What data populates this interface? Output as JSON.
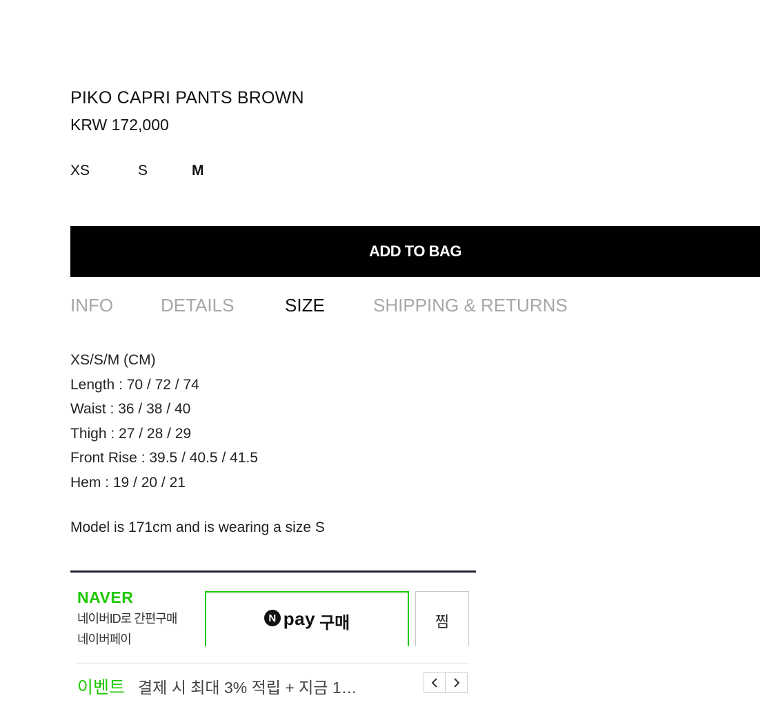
{
  "product": {
    "title": "PIKO CAPRI PANTS BROWN",
    "price": "KRW 172,000",
    "sizes": [
      "XS",
      "S",
      "M"
    ],
    "selected_size": "M",
    "add_to_bag": "ADD TO BAG"
  },
  "tabs": [
    {
      "label": "INFO",
      "active": false
    },
    {
      "label": "DETAILS",
      "active": false
    },
    {
      "label": "SIZE",
      "active": true
    },
    {
      "label": "SHIPPING & RETURNS",
      "active": false
    }
  ],
  "size_info": {
    "lines": [
      "XS/S/M (CM)",
      "Length : 70 / 72 / 74",
      "Waist : 36 / 38 / 40",
      "Thigh : 27 / 28 / 29",
      "Front Rise : 39.5 / 40.5 / 41.5",
      "Hem : 19 / 20 / 21"
    ],
    "model_note": "Model is 171cm and is wearing a size S"
  },
  "naver_pay": {
    "brand": "NAVER",
    "sub_line1": "네이버ID로 간편구매",
    "sub_line2": "네이버페이",
    "n_badge": "N",
    "pay_word": "pay",
    "buy_word": "구매",
    "zzim": "찜",
    "event_label": "이벤트",
    "event_text": "결제 시 최대 3% 적립 + 지금 1…",
    "brand_color": "#1ec800",
    "prev_icon": "chevron-left-icon",
    "next_icon": "chevron-right-icon"
  }
}
